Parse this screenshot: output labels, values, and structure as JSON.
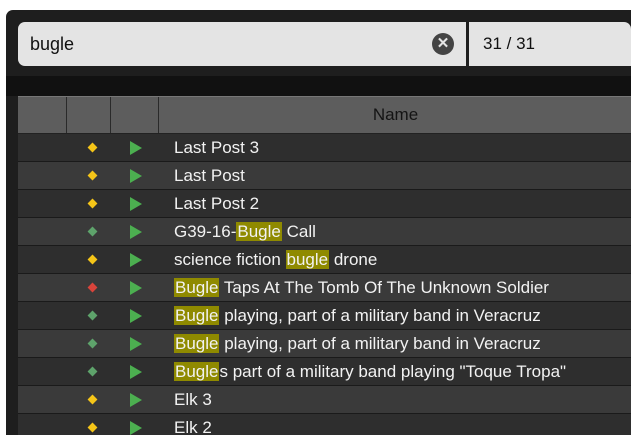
{
  "search": {
    "query": "bugle",
    "placeholder": ""
  },
  "counter": "31 / 31",
  "header": {
    "name_label": "Name"
  },
  "colors": {
    "yellow": "#f5c518",
    "green": "#5ea36b",
    "red": "#d9443b",
    "play": "#4caf50",
    "highlight": "#8f8a00"
  },
  "rows": [
    {
      "status": "yellow",
      "name": "Last Post 3",
      "highlights": []
    },
    {
      "status": "yellow",
      "name": "Last Post",
      "highlights": []
    },
    {
      "status": "yellow",
      "name": "Last Post 2",
      "highlights": []
    },
    {
      "status": "green",
      "name": "G39-16-Bugle Call",
      "highlights": [
        [
          7,
          12
        ]
      ]
    },
    {
      "status": "yellow",
      "name": "science fiction bugle drone",
      "highlights": [
        [
          16,
          21
        ]
      ]
    },
    {
      "status": "red",
      "name": "Bugle Taps At The Tomb Of The Unknown Soldier",
      "highlights": [
        [
          0,
          5
        ]
      ]
    },
    {
      "status": "green",
      "name": "Bugle playing, part of a military band in Veracruz",
      "highlights": [
        [
          0,
          5
        ]
      ]
    },
    {
      "status": "green",
      "name": "Bugle playing, part of a military band in Veracruz",
      "highlights": [
        [
          0,
          5
        ]
      ]
    },
    {
      "status": "green",
      "name": "Bugles part of a military band playing \"Toque Tropa\"",
      "highlights": [
        [
          0,
          5
        ]
      ]
    },
    {
      "status": "yellow",
      "name": "Elk 3",
      "highlights": []
    },
    {
      "status": "yellow",
      "name": "Elk 2",
      "highlights": []
    }
  ]
}
